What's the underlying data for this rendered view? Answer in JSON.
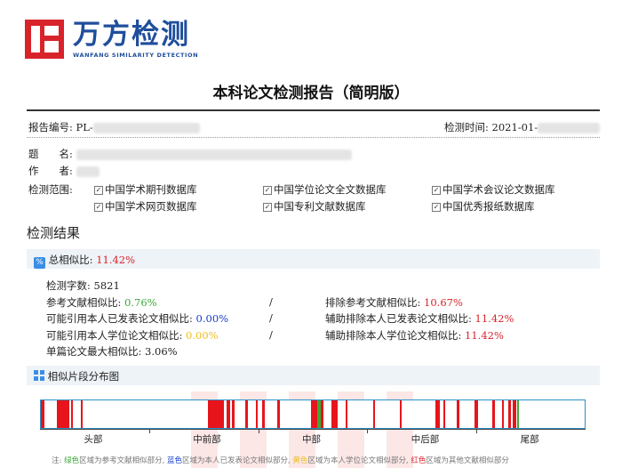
{
  "logo": {
    "cn": "万方检测",
    "en": "WANFANG SIMILARITY DETECTION"
  },
  "title": "本科论文检测报告（简明版）",
  "header": {
    "report_no_label": "报告编号:",
    "report_no_value": "PL-",
    "time_label": "检测时间:",
    "time_value": "2021-01-"
  },
  "meta": {
    "title_label": "题　　名:",
    "author_label": "作　　者:"
  },
  "scope": {
    "label": "检测范围:",
    "items": [
      "中国学术期刊数据库",
      "中国学位论文全文数据库",
      "中国学术会议论文数据库",
      "中国学术网页数据库",
      "中国专利文献数据库",
      "中国优秀报纸数据库"
    ]
  },
  "results": {
    "heading": "检测结果",
    "total_label": "总相似比:",
    "total_value": "11.42%",
    "word_count_label": "检测字数:",
    "word_count_value": "5821",
    "left": [
      {
        "label": "参考文献相似比:",
        "value": "0.76%"
      },
      {
        "label": "可能引用本人已发表论文相似比:",
        "value": "0.00%"
      },
      {
        "label": "可能引用本人学位论文相似比:",
        "value": "0.00%"
      }
    ],
    "separator": "/",
    "right": [
      {
        "label": "排除参考文献相似比:",
        "value": "10.67%"
      },
      {
        "label": "辅助排除本人已发表论文相似比:",
        "value": "11.42%"
      },
      {
        "label": "辅助排除本人学位论文相似比:",
        "value": "11.42%"
      }
    ],
    "max_single_label": "单篇论文最大相似比:",
    "max_single_value": "3.06%"
  },
  "distribution": {
    "heading": "相似片段分布图",
    "sections": [
      "头部",
      "中前部",
      "中部",
      "中后部",
      "尾部"
    ],
    "segments": [
      {
        "start": 0.0,
        "width": 0.006,
        "color": "red"
      },
      {
        "start": 0.03,
        "width": 0.022,
        "color": "red"
      },
      {
        "start": 0.056,
        "width": 0.003,
        "color": "red"
      },
      {
        "start": 0.073,
        "width": 0.004,
        "color": "red"
      },
      {
        "start": 0.308,
        "width": 0.028,
        "color": "red"
      },
      {
        "start": 0.342,
        "width": 0.006,
        "color": "red"
      },
      {
        "start": 0.352,
        "width": 0.005,
        "color": "red"
      },
      {
        "start": 0.375,
        "width": 0.006,
        "color": "red"
      },
      {
        "start": 0.395,
        "width": 0.003,
        "color": "red"
      },
      {
        "start": 0.407,
        "width": 0.004,
        "color": "red"
      },
      {
        "start": 0.435,
        "width": 0.004,
        "color": "red"
      },
      {
        "start": 0.497,
        "width": 0.011,
        "color": "red"
      },
      {
        "start": 0.508,
        "width": 0.003,
        "color": "green"
      },
      {
        "start": 0.512,
        "width": 0.003,
        "color": "green"
      },
      {
        "start": 0.515,
        "width": 0.004,
        "color": "red"
      },
      {
        "start": 0.535,
        "width": 0.01,
        "color": "red"
      },
      {
        "start": 0.56,
        "width": 0.003,
        "color": "red"
      },
      {
        "start": 0.611,
        "width": 0.004,
        "color": "red"
      },
      {
        "start": 0.66,
        "width": 0.003,
        "color": "red"
      },
      {
        "start": 0.725,
        "width": 0.008,
        "color": "red"
      },
      {
        "start": 0.74,
        "width": 0.004,
        "color": "red"
      },
      {
        "start": 0.765,
        "width": 0.004,
        "color": "red"
      },
      {
        "start": 0.798,
        "width": 0.006,
        "color": "red"
      },
      {
        "start": 0.83,
        "width": 0.005,
        "color": "red"
      },
      {
        "start": 0.848,
        "width": 0.004,
        "color": "red"
      },
      {
        "start": 0.86,
        "width": 0.004,
        "color": "red"
      },
      {
        "start": 0.868,
        "width": 0.007,
        "color": "red"
      },
      {
        "start": 0.876,
        "width": 0.003,
        "color": "green"
      }
    ],
    "colors": {
      "red": "#e8141c",
      "green": "#3aaa35",
      "blue": "#1a3ec8",
      "yellow": "#f0c020"
    }
  },
  "legend": {
    "prefix": "注:",
    "items": [
      {
        "color_word": "绿色",
        "text": "区域为参考文献相似部分,",
        "color": "#3aaa35"
      },
      {
        "color_word": "蓝色",
        "text": "区域为本人已发表论文相似部分,",
        "color": "#1a3ec8"
      },
      {
        "color_word": "黄色",
        "text": "区域为本人学位论文相似部分,",
        "color": "#f0c020"
      },
      {
        "color_word": "红色",
        "text": "区域为其他文献相似部分",
        "color": "#d9232a"
      }
    ]
  }
}
